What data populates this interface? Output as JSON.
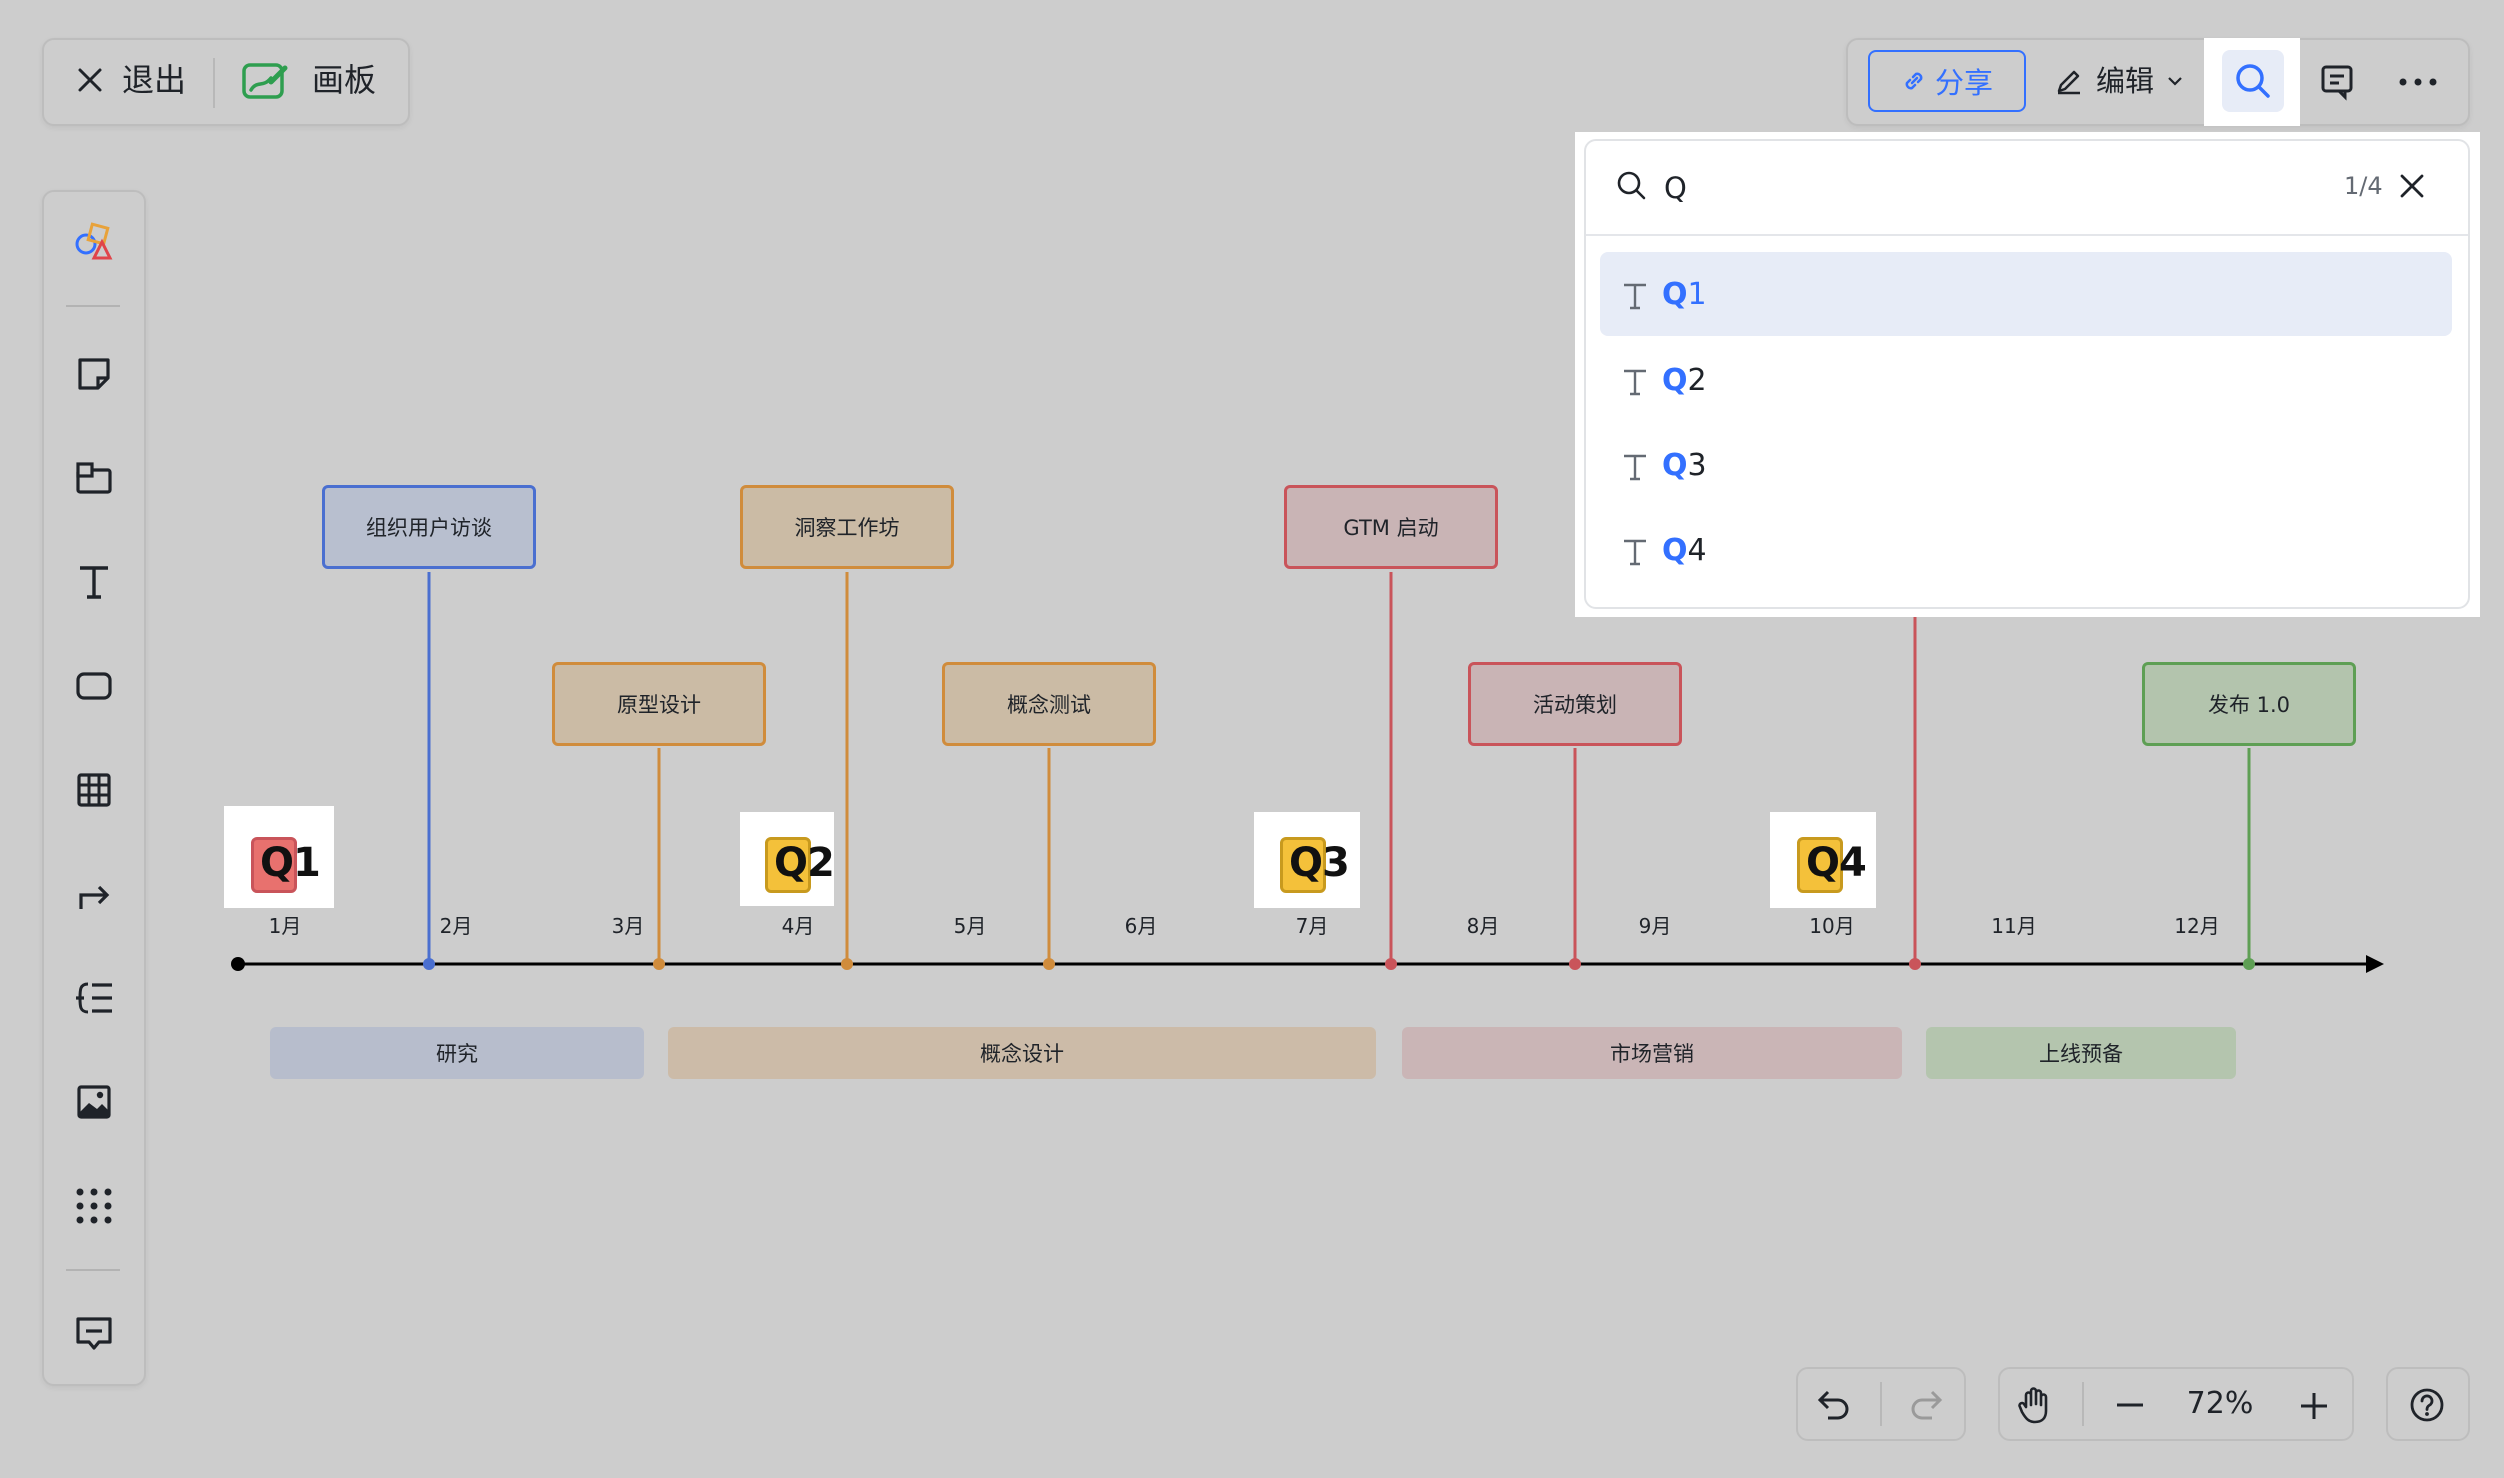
{
  "topbar": {
    "exit_label": "退出",
    "board_label": "画板",
    "share_label": "分享",
    "edit_label": "编辑"
  },
  "search": {
    "query": "Q",
    "count": "1/4",
    "results": [
      {
        "match": "Q",
        "rest": "1"
      },
      {
        "match": "Q",
        "rest": "2"
      },
      {
        "match": "Q",
        "rest": "3"
      },
      {
        "match": "Q",
        "rest": "4"
      }
    ]
  },
  "timeline": {
    "months": [
      "1月",
      "2月",
      "3月",
      "4月",
      "5月",
      "6月",
      "7月",
      "8月",
      "9月",
      "10月",
      "11月",
      "12月"
    ],
    "milestones": [
      {
        "label": "组织用户访谈"
      },
      {
        "label": "原型设计"
      },
      {
        "label": "洞察工作坊"
      },
      {
        "label": "概念测试"
      },
      {
        "label": "GTM 启动"
      },
      {
        "label": "活动策划"
      },
      {
        "label": "发布 1.0"
      }
    ],
    "phases": [
      {
        "label": "研究"
      },
      {
        "label": "概念设计"
      },
      {
        "label": "市场营销"
      },
      {
        "label": "上线预备"
      }
    ],
    "quarters": [
      "Q1",
      "Q2",
      "Q3",
      "Q4"
    ]
  },
  "zoom": {
    "level": "72%"
  },
  "colors": {
    "accent": "#3370ff",
    "blue": "#4a6fd0",
    "orange": "#d08c3c",
    "red": "#c9545a",
    "green": "#5e9f54"
  }
}
